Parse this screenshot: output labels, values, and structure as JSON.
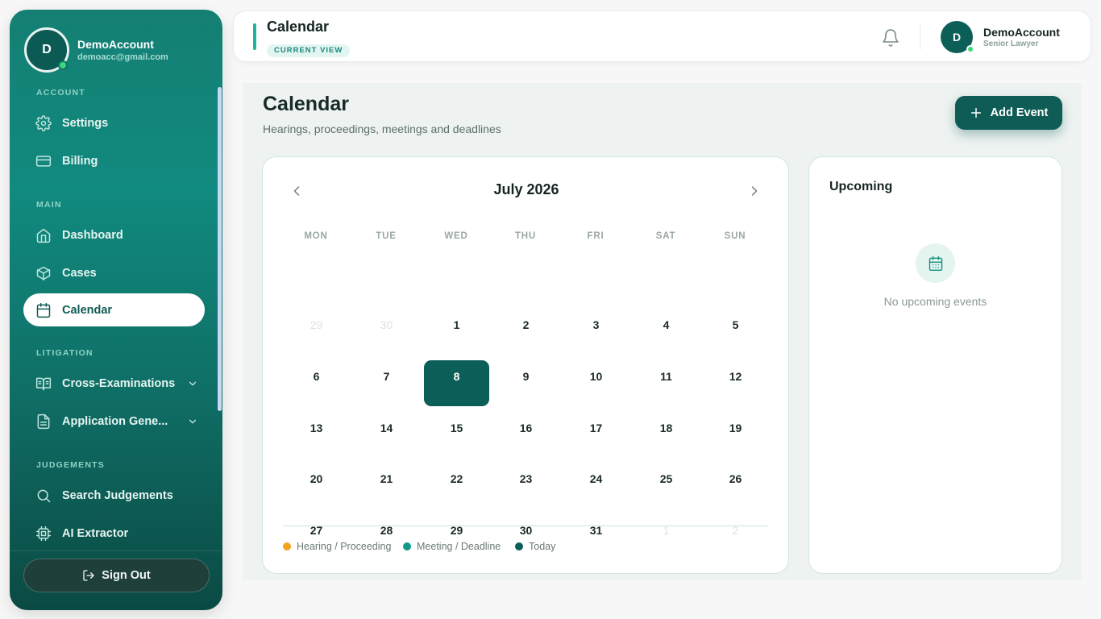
{
  "user": {
    "initial": "D",
    "name": "DemoAccount",
    "email": "demoacc@gmail.com",
    "role": "Senior Lawyer"
  },
  "sidebar": {
    "sections": {
      "account": "ACCOUNT",
      "main": "MAIN",
      "litigation": "LITIGATION",
      "judgements": "JUDGEMENTS"
    },
    "items": {
      "settings": "Settings",
      "billing": "Billing",
      "dashboard": "Dashboard",
      "cases": "Cases",
      "calendar": "Calendar",
      "cross_examinations": "Cross-Examinations",
      "application_generator": "Application Gene...",
      "search_judgements": "Search Judgements",
      "ai_extractor": "AI Extractor"
    },
    "sign_out": "Sign Out",
    "active": "Calendar"
  },
  "topbar": {
    "title": "Calendar",
    "badge": "CURRENT VIEW"
  },
  "main": {
    "title": "Calendar",
    "subtitle": "Hearings, proceedings, meetings and deadlines",
    "add_button": "Add Event"
  },
  "calendar": {
    "month_label": "July 2026",
    "weekdays": [
      "MON",
      "TUE",
      "WED",
      "THU",
      "FRI",
      "SAT",
      "SUN"
    ],
    "weeks": [
      [
        {
          "d": "29",
          "m": true
        },
        {
          "d": "30",
          "m": true
        },
        {
          "d": "1"
        },
        {
          "d": "2"
        },
        {
          "d": "3"
        },
        {
          "d": "4"
        },
        {
          "d": "5"
        }
      ],
      [
        {
          "d": "6"
        },
        {
          "d": "7"
        },
        {
          "d": "8",
          "today": true
        },
        {
          "d": "9"
        },
        {
          "d": "10"
        },
        {
          "d": "11"
        },
        {
          "d": "12"
        }
      ],
      [
        {
          "d": "13"
        },
        {
          "d": "14"
        },
        {
          "d": "15"
        },
        {
          "d": "16"
        },
        {
          "d": "17"
        },
        {
          "d": "18"
        },
        {
          "d": "19"
        }
      ],
      [
        {
          "d": "20"
        },
        {
          "d": "21"
        },
        {
          "d": "22"
        },
        {
          "d": "23"
        },
        {
          "d": "24"
        },
        {
          "d": "25"
        },
        {
          "d": "26"
        }
      ],
      [
        {
          "d": "27"
        },
        {
          "d": "28"
        },
        {
          "d": "29"
        },
        {
          "d": "30"
        },
        {
          "d": "31"
        },
        {
          "d": "1",
          "m": true
        },
        {
          "d": "2",
          "m": true
        }
      ]
    ],
    "legend": [
      {
        "label": "Hearing / Proceeding",
        "color": "#f4a31d"
      },
      {
        "label": "Meeting / Deadline",
        "color": "#13988a"
      },
      {
        "label": "Today",
        "color": "#0c5f58"
      }
    ]
  },
  "upcoming": {
    "title": "Upcoming",
    "empty_text": "No upcoming events"
  },
  "colors": {
    "primary": "#0f5c56",
    "accent": "#20b3a0",
    "online": "#3bd67a"
  }
}
